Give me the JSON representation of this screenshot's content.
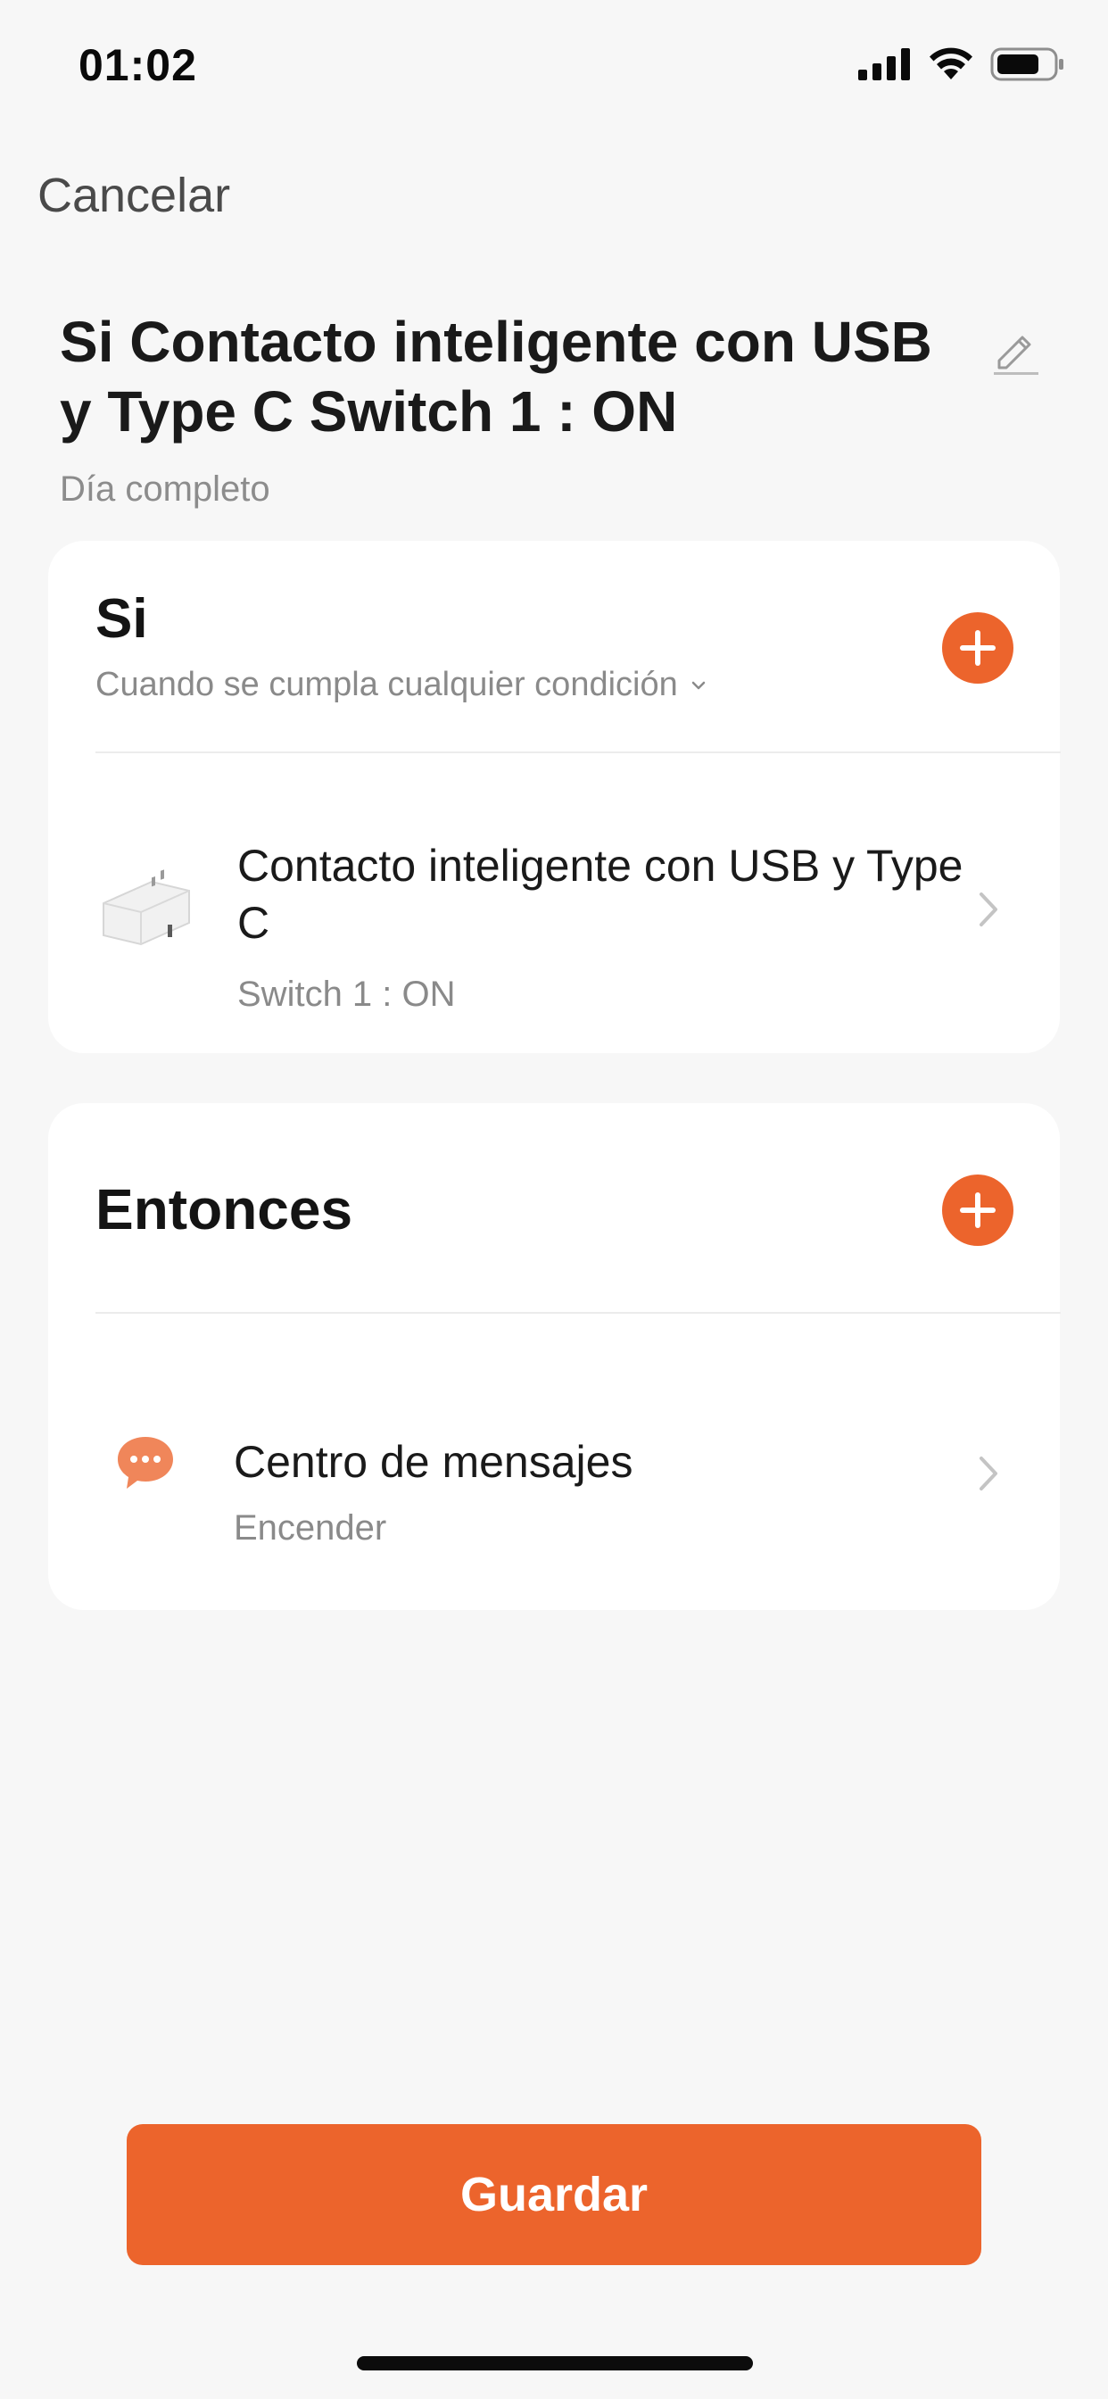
{
  "status_bar": {
    "time": "01:02",
    "icons": [
      "signal-icon",
      "wifi-icon",
      "battery-icon"
    ]
  },
  "header": {
    "cancel_label": "Cancelar",
    "title": "Si Contacto inteligente con USB y Type C Switch 1 : ON",
    "subtitle": "Día completo",
    "edit_icon": "pencil-icon"
  },
  "if_section": {
    "heading": "Si",
    "condition_mode": "Cuando se cumpla cualquier condición",
    "add_icon": "plus-icon",
    "items": [
      {
        "title": "Contacto inteligente con USB y Type C",
        "subtitle": "Switch 1 : ON",
        "icon": "smart-plug-image"
      }
    ]
  },
  "then_section": {
    "heading": "Entonces",
    "add_icon": "plus-icon",
    "items": [
      {
        "title": "Centro de mensajes",
        "subtitle": "Encender",
        "icon": "message-bubble-icon"
      }
    ]
  },
  "footer": {
    "save_label": "Guardar"
  },
  "colors": {
    "accent": "#ec642c",
    "background": "#f7f7f7",
    "card": "#ffffff",
    "secondary_text": "#8a8a8a",
    "message_icon": "#f0865a"
  }
}
